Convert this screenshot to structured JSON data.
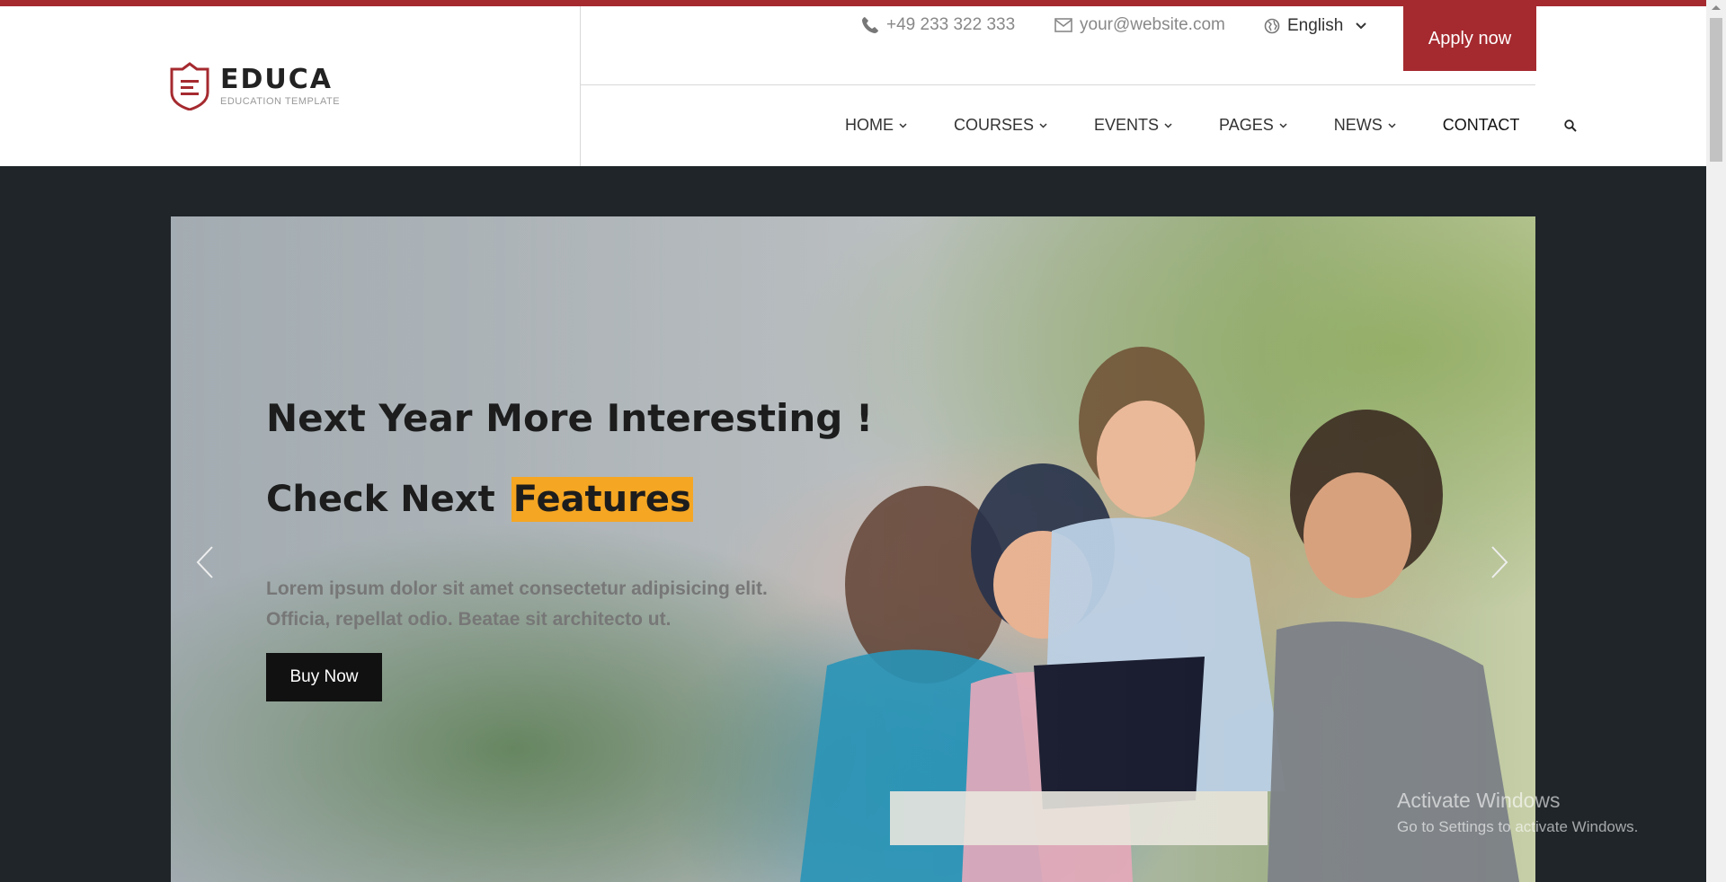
{
  "brand": {
    "name": "EDUCA",
    "tagline": "EDUCATION TEMPLATE",
    "color": "#a52a2f"
  },
  "topbar": {
    "phone": "+49 233 322 333",
    "email": "your@website.com",
    "language": "English",
    "apply_label": "Apply now",
    "icons": [
      "phone-icon",
      "mail-icon",
      "globe-icon",
      "chevron-down-icon"
    ]
  },
  "nav": {
    "items": [
      {
        "label": "HOME"
      },
      {
        "label": "COURSES"
      },
      {
        "label": "EVENTS"
      },
      {
        "label": "PAGES"
      },
      {
        "label": "NEWS"
      },
      {
        "label": "CONTACT"
      }
    ],
    "search_icon": "search-icon"
  },
  "hero": {
    "title": "Next Year More Interesting !",
    "subtitle_prefix": "Check Next",
    "subtitle_highlight": "Features",
    "highlight_color": "#f5a623",
    "text_line1": "Lorem ipsum dolor sit amet consectetur adipisicing elit.",
    "text_line2": "Officia, repellat odio. Beatae sit architecto ut.",
    "cta_label": "Buy Now",
    "icons": [
      "chevron-left-icon",
      "chevron-right-icon"
    ]
  },
  "system": {
    "watermark_title": "Activate Windows",
    "watermark_sub": "Go to Settings to activate Windows."
  }
}
